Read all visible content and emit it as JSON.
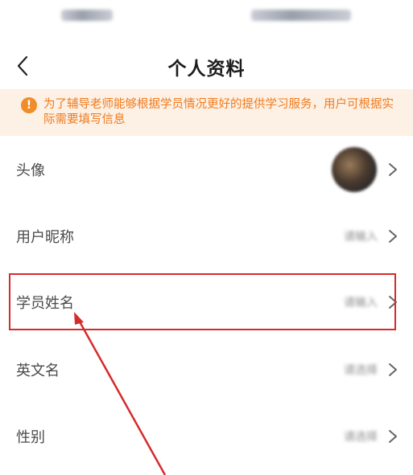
{
  "header": {
    "title": "个人资料",
    "back_icon": "chevron-left-icon"
  },
  "notice": {
    "icon_text": "!",
    "text": "为了辅导老师能够根据学员情况更好的提供学习服务，用户可根据实际需要填写信息"
  },
  "rows": [
    {
      "label": "头像",
      "type": "avatar"
    },
    {
      "label": "用户昵称",
      "value": "请输入"
    },
    {
      "label": "学员姓名",
      "value": "请输入"
    },
    {
      "label": "英文名",
      "value": "请选择"
    },
    {
      "label": "性别",
      "value": "请选择"
    }
  ],
  "colors": {
    "accent": "#f07b1e",
    "notice_bg": "#fdf0e4",
    "annotation": "#d62b2b"
  }
}
